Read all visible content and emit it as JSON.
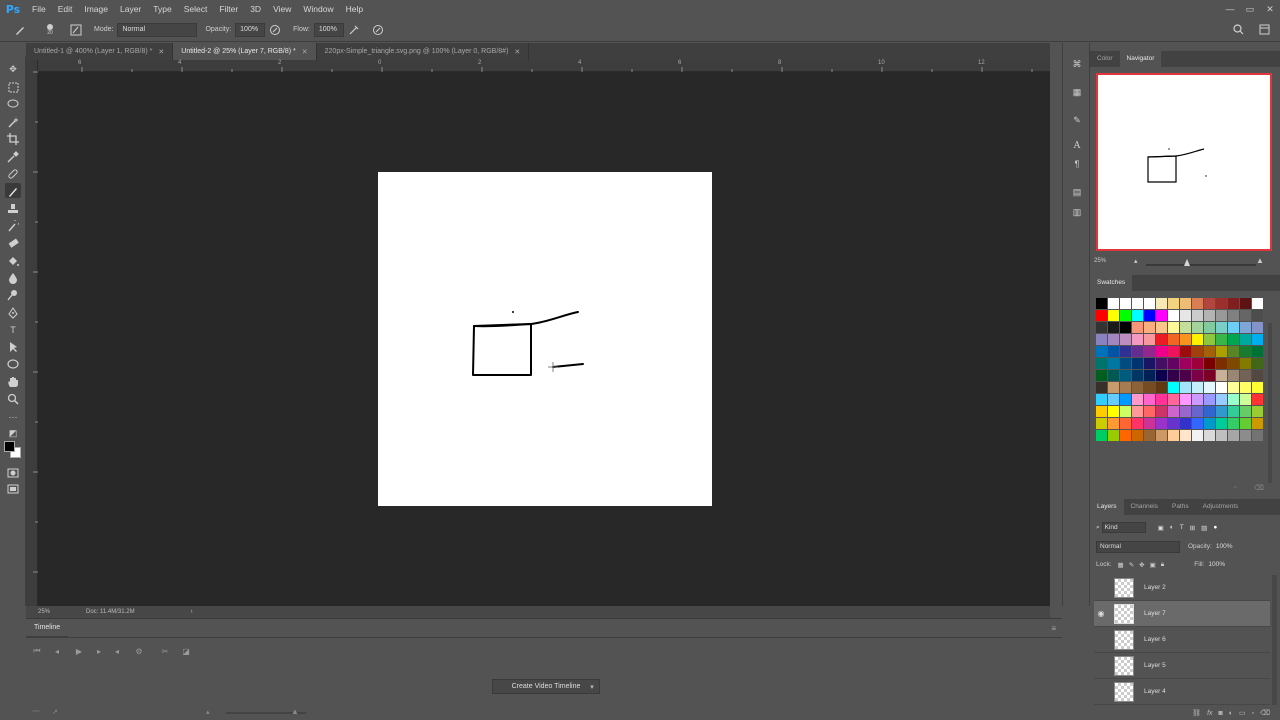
{
  "app": {
    "logo": "Ps"
  },
  "menu": [
    "File",
    "Edit",
    "Image",
    "Layer",
    "Type",
    "Select",
    "Filter",
    "3D",
    "View",
    "Window",
    "Help"
  ],
  "window_controls": {
    "minimize": "—",
    "restore": "▭",
    "close": "✕"
  },
  "options_bar": {
    "brush_size": "20",
    "mode_label": "Mode:",
    "mode_value": "Normal",
    "opacity_label": "Opacity:",
    "opacity_value": "100%",
    "flow_label": "Flow:",
    "flow_value": "100%"
  },
  "tabs": [
    {
      "label": "Untitled-1 @ 400% (Layer 1, RGB/8) *",
      "active": false
    },
    {
      "label": "Untitled-2 @ 25% (Layer 7, RGB/8) *",
      "active": true
    },
    {
      "label": "220px-Simple_triangle.svg.png @ 100% (Layer 0, RGB/8#)",
      "active": false
    }
  ],
  "ruler_ticks": [
    "6",
    "4",
    "2",
    "0",
    "2",
    "4",
    "6",
    "8",
    "10",
    "12"
  ],
  "status": {
    "zoom": "25%",
    "doc": "Doc: 11.4M/31.2M"
  },
  "timeline": {
    "tab": "Timeline",
    "create_button": "Create Video Timeline"
  },
  "color_panel": {
    "tab_color": "Color",
    "tab_navigator": "Navigator",
    "zoom": "25%"
  },
  "swatches_panel": {
    "tab": "Swatches",
    "rows": [
      [
        "#000000",
        "#ffffff",
        "#ffffff",
        "#ffffff",
        "#ffffff",
        "#f6e9b6",
        "#f3d37f",
        "#eebd75",
        "#d97d55",
        "#b2453d",
        "#9a2f2c",
        "#7f1f1f",
        "#5c1313",
        "#ffffff"
      ],
      [
        "#ff0000",
        "#ffff00",
        "#00ff00",
        "#00ffff",
        "#0000ff",
        "#ff00ff",
        "#ffffff",
        "#e6e6e6",
        "#cccccc",
        "#b3b3b3",
        "#999999",
        "#808080",
        "#666666",
        "#4d4d4d"
      ],
      [
        "#333333",
        "#1a1a1a",
        "#000000",
        "#f7977a",
        "#f9ad81",
        "#fdc68a",
        "#fff79a",
        "#c4df9b",
        "#a3d39c",
        "#82ca9d",
        "#7bcdc8",
        "#6ecff6",
        "#7ea7d8",
        "#8493ca"
      ],
      [
        "#8882be",
        "#a187be",
        "#bc8dbf",
        "#f49ac2",
        "#f6989d",
        "#ed1c24",
        "#f26522",
        "#f7941d",
        "#fff200",
        "#8dc73f",
        "#39b54a",
        "#00a651",
        "#00a99d",
        "#00aeef"
      ],
      [
        "#0072bc",
        "#0054a6",
        "#2e3192",
        "#662d91",
        "#92278f",
        "#ec008c",
        "#ed145b",
        "#9e0b0f",
        "#a0410d",
        "#a36209",
        "#aba000",
        "#598527",
        "#197b30",
        "#007236"
      ],
      [
        "#00746b",
        "#0076a3",
        "#004b80",
        "#003471",
        "#1b1464",
        "#440e62",
        "#630460",
        "#9e005d",
        "#9e0039",
        "#790000",
        "#7b2e00",
        "#7d4900",
        "#827b00",
        "#406618"
      ],
      [
        "#005e20",
        "#005952",
        "#005b7f",
        "#003663",
        "#002157",
        "#0d004c",
        "#32004b",
        "#4b0049",
        "#7b0046",
        "#7a0026",
        "#c7b299",
        "#998675",
        "#736357",
        "#534741"
      ],
      [
        "#37302a",
        "#c69c6d",
        "#a67c52",
        "#8c6239",
        "#754c24",
        "#603913",
        "#00ffff",
        "#a6e4f9",
        "#c5eefb",
        "#e3f7fd",
        "#ffffff",
        "#ffff99",
        "#ffff66",
        "#ffff33"
      ],
      [
        "#33ccff",
        "#66ccff",
        "#0099ff",
        "#ff99cc",
        "#ff66cc",
        "#ff3399",
        "#ff6699",
        "#ff99ff",
        "#cc99ff",
        "#9999ff",
        "#99ccff",
        "#99ffcc",
        "#ccff99",
        "#ff3333"
      ],
      [
        "#ffcc00",
        "#ffff00",
        "#ccff66",
        "#ff9999",
        "#ff6666",
        "#cc3366",
        "#cc66cc",
        "#9966cc",
        "#6666cc",
        "#3366cc",
        "#3399cc",
        "#33cc99",
        "#66cc66",
        "#99cc33"
      ],
      [
        "#cccc00",
        "#ff9933",
        "#ff6633",
        "#ff3366",
        "#cc3399",
        "#9933cc",
        "#6633cc",
        "#3333cc",
        "#3366ff",
        "#0099cc",
        "#00cc99",
        "#33cc66",
        "#66cc33",
        "#cc9900"
      ],
      [
        "#00cc66",
        "#99cc00",
        "#ff6600",
        "#cc6600",
        "#996633",
        "#cc9966",
        "#ffcc99",
        "#ffe5cc",
        "#f2f2f2",
        "#d9d9d9",
        "#bfbfbf",
        "#a6a6a6",
        "#8c8c8c",
        "#737373"
      ]
    ]
  },
  "layers_panel": {
    "tabs": [
      "Layers",
      "Channels",
      "Paths",
      "Adjustments"
    ],
    "kind": "Kind",
    "blend_mode": "Normal",
    "opacity_label": "Opacity:",
    "opacity_value": "100%",
    "lock_label": "Lock:",
    "fill_label": "Fill:",
    "fill_value": "100%",
    "layers": [
      {
        "name": "Layer 2",
        "visible": false,
        "active": false
      },
      {
        "name": "Layer 7",
        "visible": true,
        "active": true
      },
      {
        "name": "Layer 6",
        "visible": false,
        "active": false
      },
      {
        "name": "Layer 5",
        "visible": false,
        "active": false
      },
      {
        "name": "Layer 4",
        "visible": false,
        "active": false
      }
    ]
  }
}
